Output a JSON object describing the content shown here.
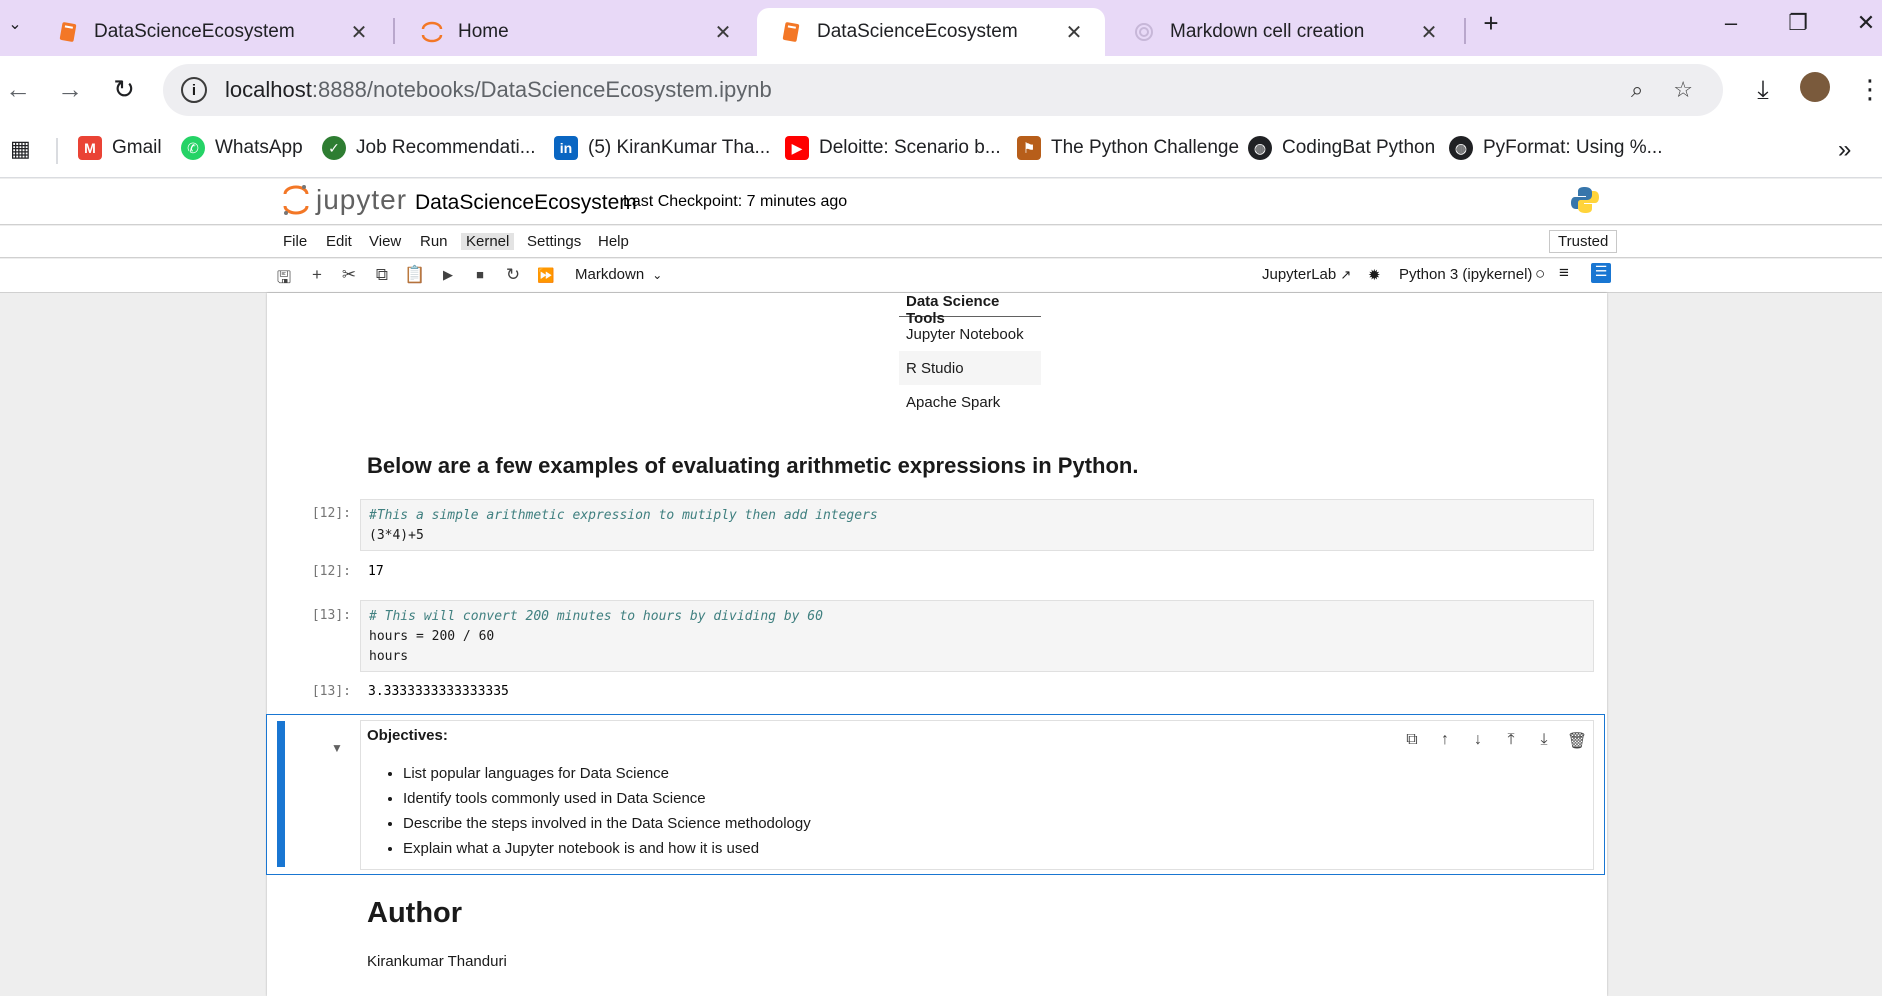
{
  "browser": {
    "tabs": [
      {
        "title": "DataScienceEcosystem",
        "icon": "notebook-icon",
        "active": false
      },
      {
        "title": "Home",
        "icon": "jupyter-icon",
        "active": false
      },
      {
        "title": "DataScienceEcosystem",
        "icon": "notebook-icon",
        "active": true
      },
      {
        "title": "Markdown cell creation",
        "icon": "openai-icon",
        "active": false
      }
    ],
    "new_tab": "+",
    "close_glyph": "✕",
    "url_host": "localhost",
    "url_path": ":8888/notebooks/DataScienceEcosystem.ipynb",
    "bookmarks": [
      {
        "label": "Gmail",
        "icon": "gmail-icon",
        "color": "#ea4335"
      },
      {
        "label": "WhatsApp",
        "icon": "whatsapp-icon",
        "color": "#25d366"
      },
      {
        "label": "Job Recommendati...",
        "icon": "job-icon",
        "color": "#2e7d32"
      },
      {
        "label": "(5) KiranKumar Tha...",
        "icon": "linkedin-icon",
        "color": "#0a66c2"
      },
      {
        "label": "Deloitte: Scenario b...",
        "icon": "youtube-icon",
        "color": "#ff0000"
      },
      {
        "label": "The Python Challenge",
        "icon": "python-challenge-icon",
        "color": "#b75e1a"
      },
      {
        "label": "CodingBat Python",
        "icon": "globe-icon",
        "color": "#202124"
      },
      {
        "label": "PyFormat: Using %...",
        "icon": "globe-icon",
        "color": "#202124"
      }
    ]
  },
  "jupyter": {
    "logo_text": "jupyter",
    "notebook_title": "DataScienceEcosystem",
    "checkpoint": "Last Checkpoint: 7 minutes ago",
    "menu": [
      "File",
      "Edit",
      "View",
      "Run",
      "Kernel",
      "Settings",
      "Help"
    ],
    "trusted": "Trusted",
    "cell_type": "Markdown",
    "jupyterlab_link": "JupyterLab",
    "kernel_name": "Python 3 (ipykernel)"
  },
  "notebook": {
    "tools_table": {
      "header": "Data Science Tools",
      "rows": [
        "Jupyter Notebook",
        "R Studio",
        "Apache Spark"
      ]
    },
    "heading": "Below are a few examples of evaluating arithmetic expressions in Python.",
    "cells": [
      {
        "prompt_in": "[12]:",
        "code_comment": "#This a simple arithmetic expression to mutiply then add integers",
        "code_line": "(3*4)+5",
        "prompt_out": "[12]:",
        "output": "17"
      },
      {
        "prompt_in": "[13]:",
        "code_comment": "# This will convert 200 minutes to hours by dividing by 60",
        "code_line": "hours = 200 / 60",
        "code_line2": "hours",
        "prompt_out": "[13]:",
        "output": "3.3333333333333335"
      }
    ],
    "objectives": {
      "title": "Objectives:",
      "items": [
        "List popular languages for Data Science",
        "Identify tools commonly used in Data Science",
        "Describe the steps involved in the Data Science methodology",
        "Explain what a Jupyter notebook is and how it is used"
      ]
    },
    "author": {
      "heading": "Author",
      "name": "Kirankumar Thanduri"
    }
  }
}
